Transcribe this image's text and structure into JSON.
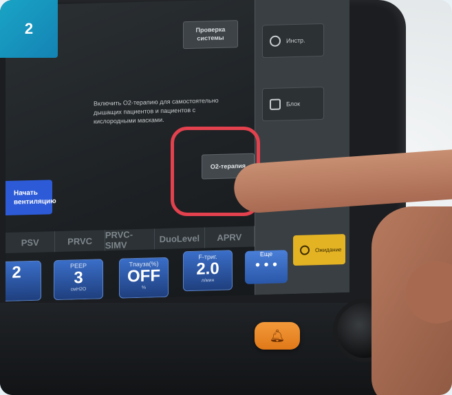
{
  "step_badge": "2",
  "screen": {
    "check_button": "Проверка\nсистемы",
    "o2_description": "Включить О2-терапию для самостоятельно дышащих пациентов и пациентов с кислородными масками.",
    "o2_button": "О2-терапия",
    "start_button": "Начать\nвентиляцию",
    "side_buttons": [
      {
        "icon": "settings-icon",
        "label": "Инстр."
      },
      {
        "icon": "unlock-icon",
        "label": "Блок"
      }
    ],
    "modes": [
      "PSV",
      "PRVC",
      "PRVC-SIMV",
      "DuoLevel",
      "APRV"
    ],
    "params": [
      {
        "label": "",
        "value": "2",
        "unit": ""
      },
      {
        "label": "PEEP",
        "value": "3",
        "unit": "смH2O"
      },
      {
        "label": "Tпауза(%)",
        "value": "OFF",
        "unit": "%"
      },
      {
        "label": "F-триг.",
        "value": "2.0",
        "unit": "л/мин"
      }
    ],
    "more_button": {
      "label": "Еще",
      "dots": "• • •"
    },
    "standby_button": "Ожидание"
  },
  "colors": {
    "badge": "#1483b5",
    "highlight": "#e2414d",
    "accent_blue": "#2d5bd8",
    "standby": "#e3b324",
    "alarm": "#f08a2a"
  }
}
